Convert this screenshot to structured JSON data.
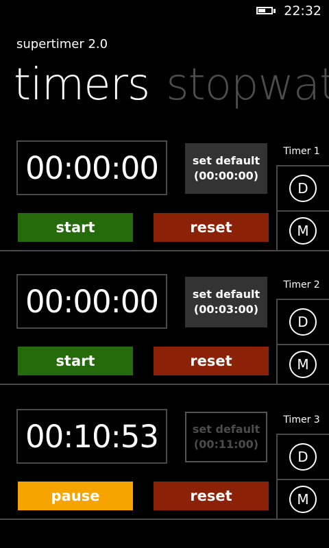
{
  "status": {
    "time": "22:32"
  },
  "app": {
    "title": "supertimer 2.0"
  },
  "pivot": {
    "active": "timers",
    "next": "stopwat"
  },
  "timers": [
    {
      "label": "Timer 1",
      "time": "00:00:00",
      "default_line1": "set default",
      "default_line2": "(00:00:00)",
      "action": "start",
      "reset": "reset",
      "d": "D",
      "m": "M"
    },
    {
      "label": "Timer 2",
      "time": "00:00:00",
      "default_line1": "set default",
      "default_line2": "(00:03:00)",
      "action": "start",
      "reset": "reset",
      "d": "D",
      "m": "M"
    },
    {
      "label": "Timer 3",
      "time": "00:10:53",
      "default_line1": "set default",
      "default_line2": "(00:11:00)",
      "action": "pause",
      "reset": "reset",
      "d": "D",
      "m": "M"
    }
  ],
  "colors": {
    "start": "#256a0b",
    "pause": "#f5a400",
    "reset": "#8b2106"
  },
  "icons": {
    "battery": "battery-icon"
  }
}
